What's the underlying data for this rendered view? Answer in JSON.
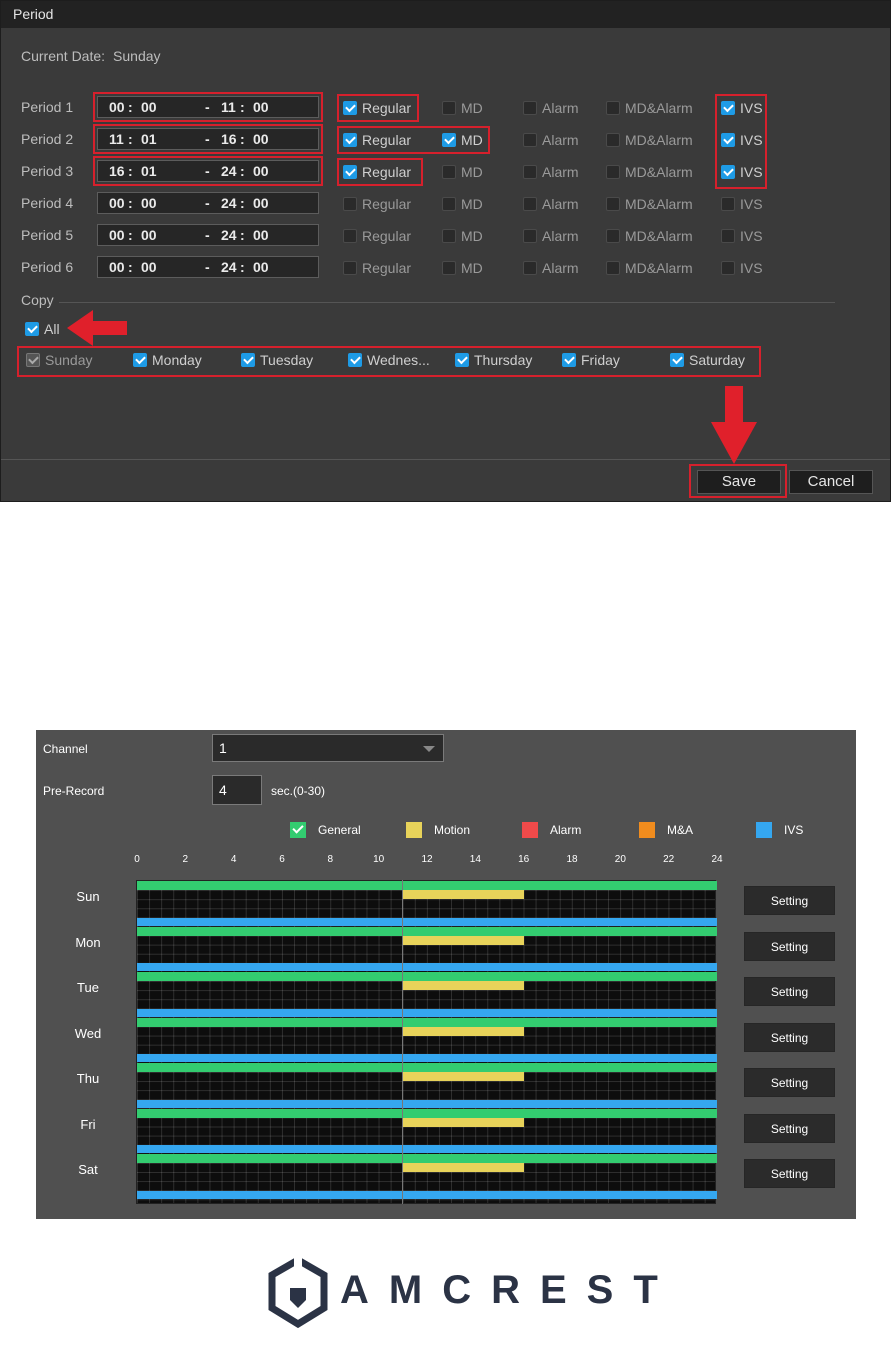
{
  "period_dialog": {
    "title": "Period",
    "current_date_label": "Current Date:",
    "current_date_value": "Sunday",
    "periods": [
      {
        "label": "Period 1",
        "start_h": "00",
        "start_m": "00",
        "end_h": "11",
        "end_m": "00",
        "regular": true,
        "md": false,
        "alarm": false,
        "mdalarm": false,
        "ivs": true
      },
      {
        "label": "Period 2",
        "start_h": "11",
        "start_m": "01",
        "end_h": "16",
        "end_m": "00",
        "regular": true,
        "md": true,
        "alarm": false,
        "mdalarm": false,
        "ivs": true
      },
      {
        "label": "Period 3",
        "start_h": "16",
        "start_m": "01",
        "end_h": "24",
        "end_m": "00",
        "regular": true,
        "md": false,
        "alarm": false,
        "mdalarm": false,
        "ivs": true
      },
      {
        "label": "Period 4",
        "start_h": "00",
        "start_m": "00",
        "end_h": "24",
        "end_m": "00",
        "regular": false,
        "md": false,
        "alarm": false,
        "mdalarm": false,
        "ivs": false
      },
      {
        "label": "Period 5",
        "start_h": "00",
        "start_m": "00",
        "end_h": "24",
        "end_m": "00",
        "regular": false,
        "md": false,
        "alarm": false,
        "mdalarm": false,
        "ivs": false
      },
      {
        "label": "Period 6",
        "start_h": "00",
        "start_m": "00",
        "end_h": "24",
        "end_m": "00",
        "regular": false,
        "md": false,
        "alarm": false,
        "mdalarm": false,
        "ivs": false
      }
    ],
    "type_labels": {
      "regular": "Regular",
      "md": "MD",
      "alarm": "Alarm",
      "mdalarm": "MD&Alarm",
      "ivs": "IVS"
    },
    "time_separator": ":",
    "range_separator": "-",
    "copy_label": "Copy",
    "all_label": "All",
    "all_checked": true,
    "days": [
      {
        "label": "Sunday",
        "checked": true,
        "disabled": true
      },
      {
        "label": "Monday",
        "checked": true
      },
      {
        "label": "Tuesday",
        "checked": true
      },
      {
        "label": "Wednes...",
        "checked": true
      },
      {
        "label": "Thursday",
        "checked": true
      },
      {
        "label": "Friday",
        "checked": true
      },
      {
        "label": "Saturday",
        "checked": true
      }
    ],
    "save_label": "Save",
    "cancel_label": "Cancel"
  },
  "schedule": {
    "channel_label": "Channel",
    "channel_value": "1",
    "prerecord_label": "Pre-Record",
    "prerecord_value": "4",
    "prerecord_unit": "sec.(0-30)",
    "legend": [
      {
        "label": "General",
        "color": "#33cc70"
      },
      {
        "label": "Motion",
        "color": "#e8d35a"
      },
      {
        "label": "Alarm",
        "color": "#f04a4a"
      },
      {
        "label": "M&A",
        "color": "#f08c1e"
      },
      {
        "label": "IVS",
        "color": "#35a7f0"
      }
    ],
    "ticks": [
      "0",
      "2",
      "4",
      "6",
      "8",
      "10",
      "12",
      "14",
      "16",
      "18",
      "20",
      "22",
      "24"
    ],
    "days": [
      "Sun",
      "Mon",
      "Tue",
      "Wed",
      "Thu",
      "Fri",
      "Sat"
    ],
    "setting_label": "Setting",
    "day_bars": {
      "general": [
        0,
        24
      ],
      "motion": [
        11,
        16
      ],
      "ivs": [
        0,
        24
      ]
    }
  },
  "logo": {
    "text": "AMCREST"
  }
}
